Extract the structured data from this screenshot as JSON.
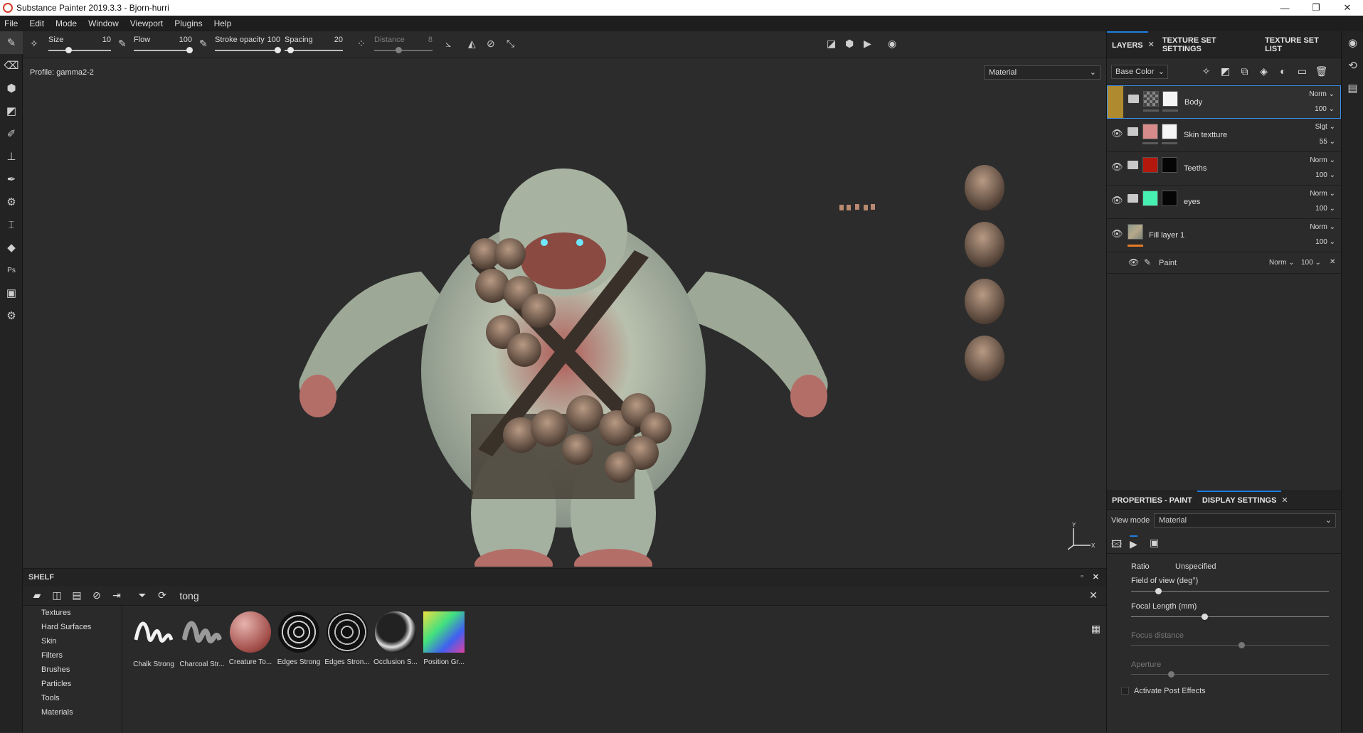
{
  "window": {
    "title": "Substance Painter 2019.3.3 - Bjorn-hurri",
    "minimize": "—",
    "maximize": "❐",
    "close": "✕"
  },
  "menu": [
    "File",
    "Edit",
    "Mode",
    "Window",
    "Viewport",
    "Plugins",
    "Help"
  ],
  "toolbar": {
    "size_label": "Size",
    "size_value": "10",
    "flow_label": "Flow",
    "flow_value": "100",
    "stroke_label": "Stroke opacity",
    "stroke_value": "100",
    "spacing_label": "Spacing",
    "spacing_value": "20",
    "distance_label": "Distance",
    "distance_value": "8"
  },
  "viewport": {
    "profile": "Profile: gamma2-2",
    "mode_select": "Material"
  },
  "layers_panel": {
    "tabs": [
      "LAYERS",
      "TEXTURE SET SETTINGS",
      "TEXTURE SET LIST"
    ],
    "channel": "Base Color",
    "layers": [
      {
        "name": "Body",
        "blend": "Norm",
        "opacity": "100",
        "selected": true
      },
      {
        "name": "Skin textture",
        "blend": "Slgt",
        "opacity": "55"
      },
      {
        "name": "Teeths",
        "blend": "Norm",
        "opacity": "100"
      },
      {
        "name": "eyes",
        "blend": "Norm",
        "opacity": "100"
      },
      {
        "name": "Fill layer 1",
        "blend": "Norm",
        "opacity": "100"
      }
    ],
    "paint": {
      "name": "Paint",
      "blend": "Norm",
      "opacity": "100"
    }
  },
  "props_panel": {
    "tabs": [
      "PROPERTIES - PAINT",
      "DISPLAY SETTINGS"
    ],
    "view_mode_label": "View mode",
    "view_mode_value": "Material",
    "ratio_label": "Ratio",
    "ratio_value": "Unspecified",
    "fov_label": "Field of view (deg°)",
    "focal_label": "Focal Length (mm)",
    "focus_label": "Focus distance",
    "aperture_label": "Aperture",
    "post_effects": "Activate Post Effects"
  },
  "shelf": {
    "title": "SHELF",
    "search": "tong",
    "categories": [
      "Textures",
      "Hard Surfaces",
      "Skin",
      "Filters",
      "Brushes",
      "Particles",
      "Tools",
      "Materials"
    ],
    "items": [
      "Chalk Strong",
      "Charcoal Str...",
      "Creature To...",
      "Edges Strong",
      "Edges Stron...",
      "Occlusion S...",
      "Position Gr..."
    ]
  },
  "colors": {
    "accent": "#1f7fe0",
    "selected_layer_eye": "#b08a2e"
  }
}
